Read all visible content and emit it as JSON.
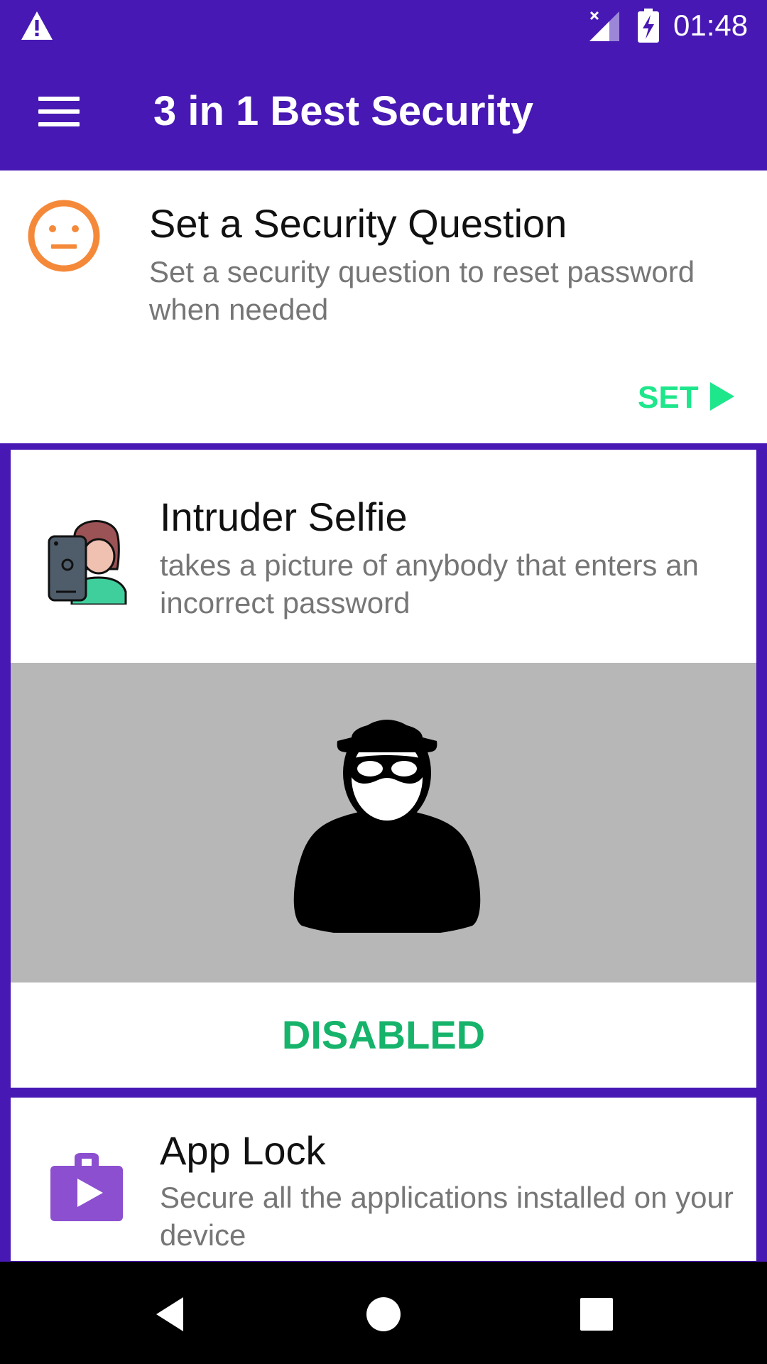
{
  "status_bar": {
    "time": "01:48",
    "icons": [
      "warning-icon",
      "signal-icon",
      "battery-charging-icon"
    ]
  },
  "toolbar": {
    "title": "3 in 1 Best Security",
    "menu_icon": "hamburger-menu-icon"
  },
  "security_question": {
    "title": "Set a Security Question",
    "description": "Set a security question to reset password when needed",
    "action_label": "SET",
    "icon": "neutral-face-icon",
    "accent_color": "#1de68b"
  },
  "intruder_selfie": {
    "title": "Intruder Selfie",
    "description": "takes a picture of anybody that enters an incorrect password",
    "status": "DISABLED",
    "icon": "selfie-person-icon",
    "image": "masked-thief-silhouette",
    "status_color": "#16b36b"
  },
  "app_lock": {
    "title": "App Lock",
    "description": "Secure all the applications installed on your device",
    "icon": "play-store-bag-icon"
  },
  "nav_bar": {
    "icons": [
      "back-icon",
      "home-icon",
      "recents-icon"
    ]
  },
  "colors": {
    "primary": "#4718b3",
    "orange": "#f5893a",
    "purple_icon": "#8c4fd0"
  }
}
